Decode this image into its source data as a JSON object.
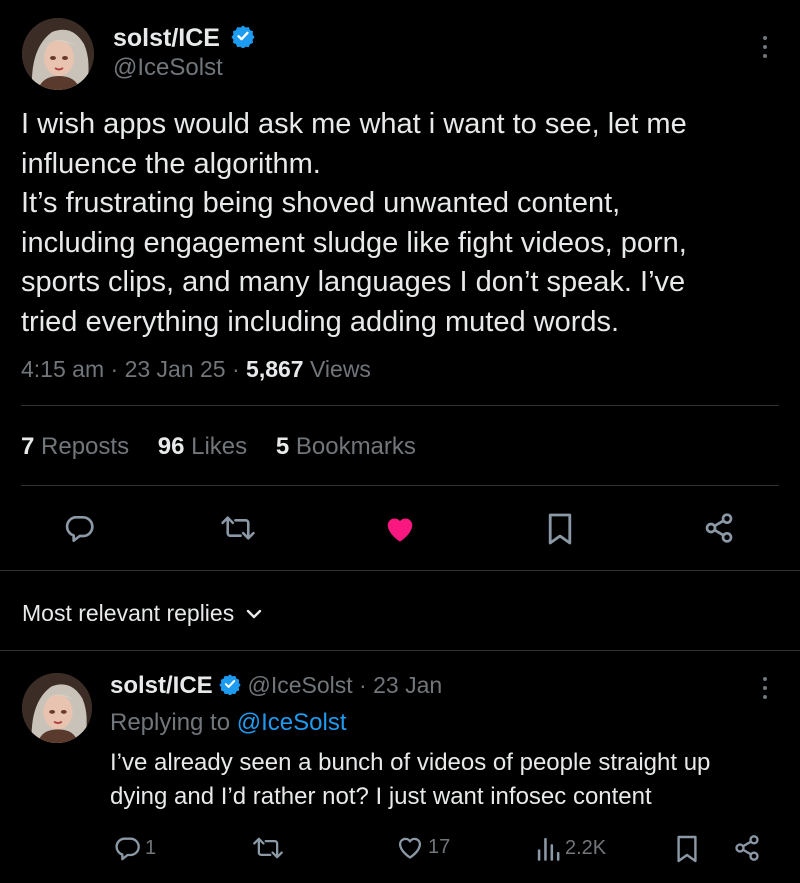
{
  "post": {
    "author_name": "solst/ICE",
    "author_handle": "@IceSolst",
    "text_lines": [
      "I wish apps would ask me what i want to see, let me",
      "influence the algorithm.",
      "It’s frustrating being shoved unwanted content,",
      "including engagement sludge like fight videos, porn,",
      "sports clips, and many languages I don’t speak. I’ve",
      "tried everything including adding muted words."
    ],
    "time": "4:15 am",
    "sep1": "·",
    "date": "23 Jan 25",
    "sep2": "·",
    "views_count": "5,867",
    "views_label": "Views",
    "reposts_count": "7",
    "reposts_label": "Reposts",
    "likes_count": "96",
    "likes_label": "Likes",
    "bookmarks_count": "5",
    "bookmarks_label": "Bookmarks",
    "actions": [
      "reply-icon",
      "repost-icon",
      "heart-filled-icon",
      "bookmark-icon",
      "share-icon"
    ]
  },
  "replies_section": {
    "title": "Most relevant replies"
  },
  "reply": {
    "author_name": "solst/ICE",
    "author_handle": "@IceSolst",
    "sep": "·",
    "date": "23 Jan",
    "replying_prefix": "Replying to",
    "replying_handle": "@IceSolst",
    "text_lines": [
      "I’ve already seen a bunch of videos of people straight up",
      "dying and I’d rather not? I just want infosec content"
    ],
    "reply_count": "1",
    "like_count": "17",
    "views_count": "2.2K"
  },
  "colors": {
    "background": "#000000",
    "text": "#e7e9ea",
    "muted": "#71767b",
    "accent": "#1d9bf0",
    "like": "#f91880",
    "divider": "#2f3336"
  }
}
